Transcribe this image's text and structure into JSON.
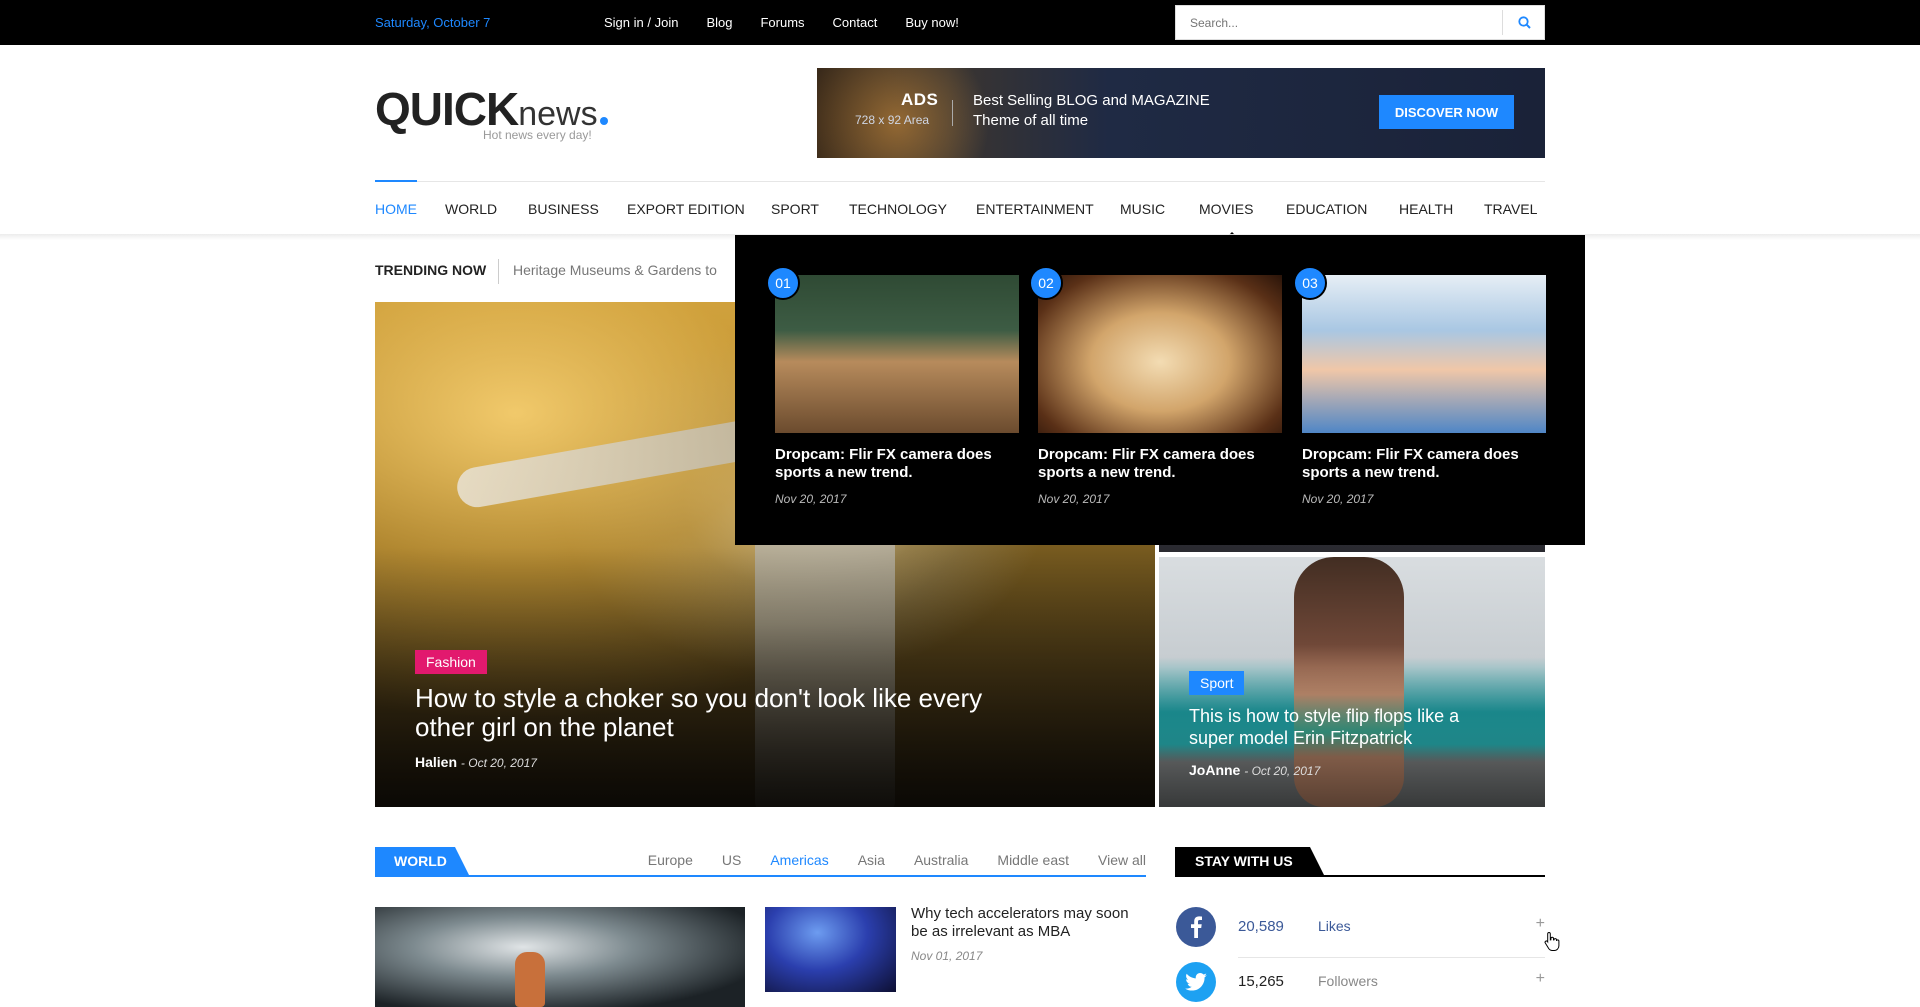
{
  "topbar": {
    "date": "Saturday, October 7",
    "links": [
      "Sign in / Join",
      "Blog",
      "Forums",
      "Contact",
      "Buy now!"
    ],
    "search_placeholder": "Search..."
  },
  "logo": {
    "brand_bold": "QUICK",
    "brand_light": "news",
    "tagline": "Hot news every day!"
  },
  "banner": {
    "ads": "ADS",
    "area": "728 x 92 Area",
    "line1": "Best Selling BLOG and MAGAZINE",
    "line2": "Theme of all time",
    "cta": "DISCOVER NOW"
  },
  "nav": {
    "items": [
      "HOME",
      "WORLD",
      "BUSINESS",
      "EXPORT EDITION",
      "SPORT",
      "TECHNOLOGY",
      "ENTERTAINMENT",
      "MUSIC",
      "MOVIES",
      "EDUCATION",
      "HEALTH",
      "TRAVEL"
    ],
    "active": "HOME",
    "open_menu": "MOVIES"
  },
  "trending": {
    "label": "TRENDING NOW",
    "text": "Heritage Museums & Gardens to"
  },
  "hero": {
    "tag": "Fashion",
    "tag_color": "#e2196e",
    "title": "How to style a choker so you don't look like every other girl on the planet",
    "author": "Halien",
    "date": "- Oct 20, 2017"
  },
  "side": {
    "tag": "Sport",
    "tag_color": "#1e88ff",
    "title": "This is how to style flip flops like a super model Erin Fitzpatrick",
    "author": "JoAnne",
    "date": "- Oct 20, 2017"
  },
  "dropdown": {
    "cards": [
      {
        "num": "01",
        "title": "Dropcam: Flir FX camera does sports a new trend.",
        "date": "Nov 20, 2017"
      },
      {
        "num": "02",
        "title": "Dropcam: Flir FX camera does sports a new trend.",
        "date": "Nov 20, 2017"
      },
      {
        "num": "03",
        "title": "Dropcam: Flir FX camera does sports a new trend.",
        "date": "Nov 20, 2017"
      }
    ]
  },
  "world": {
    "tab": "WORLD",
    "links": [
      "Europe",
      "US",
      "Americas",
      "Asia",
      "Australia",
      "Middle east",
      "View all"
    ],
    "active": "Americas",
    "article_title": "Why tech accelerators may soon be as irrelevant as MBA",
    "article_date": "Nov 01, 2017"
  },
  "stay": {
    "tab": "STAY WITH US",
    "social": [
      {
        "icon": "facebook-icon",
        "count": "20,589",
        "kind": "Likes",
        "color": "#3b5998"
      },
      {
        "icon": "twitter-icon",
        "count": "15,265",
        "kind": "Followers",
        "color": "#1da1f2"
      }
    ]
  },
  "colors": {
    "accent": "#1e88ff"
  }
}
